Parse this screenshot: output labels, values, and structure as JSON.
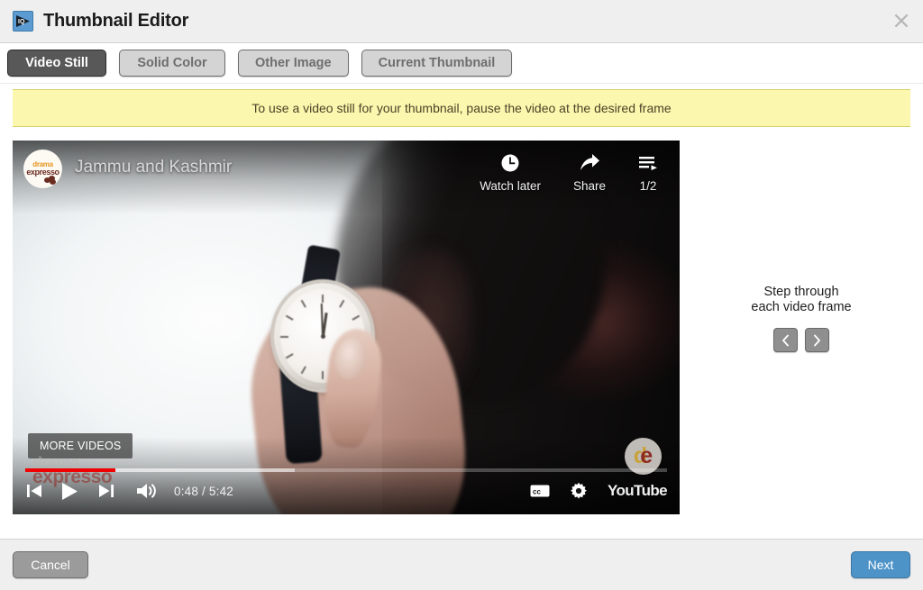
{
  "window": {
    "title": "Thumbnail Editor",
    "app_icon": "play-badge-icon",
    "close_icon": "close-icon"
  },
  "tabs": [
    {
      "label": "Video Still",
      "active": true
    },
    {
      "label": "Solid Color",
      "active": false
    },
    {
      "label": "Other Image",
      "active": false
    },
    {
      "label": "Current Thumbnail",
      "active": false
    }
  ],
  "notice": {
    "text": "To use a video still for your thumbnail, pause the video at the desired frame",
    "bg": "#fbf7ae",
    "border": "#d6cf6a"
  },
  "player": {
    "channel_avatar": {
      "line1": "drama",
      "line2": "expresso"
    },
    "video_title": "Jammu and Kashmir",
    "actions": [
      {
        "label": "Watch later",
        "icon": "clock-icon"
      },
      {
        "label": "Share",
        "icon": "share-arrow-icon"
      },
      {
        "label": "1/2",
        "icon": "playlist-icon"
      }
    ],
    "more_videos_label": "MORE VIDEOS",
    "watermark": {
      "line1": "drama",
      "line2": "expresso"
    },
    "logo_badge": {
      "left": "d",
      "right": "e"
    },
    "progress": {
      "played_percent": 14,
      "buffered_percent": 42,
      "bar_color": "#f00000"
    },
    "controls": {
      "prev_icon": "previous-track-icon",
      "play_icon": "play-icon",
      "next_icon": "next-track-icon",
      "volume_icon": "volume-icon",
      "time": "0:48 / 5:42",
      "cc_icon": "closed-captions-icon",
      "settings_icon": "gear-icon",
      "brand": "YouTube"
    }
  },
  "step_panel": {
    "label_line1": "Step through",
    "label_line2": "each video frame",
    "prev_icon": "chevron-left-icon",
    "next_icon": "chevron-right-icon"
  },
  "footer": {
    "cancel_label": "Cancel",
    "next_label": "Next",
    "next_color": "#4d93c8"
  }
}
